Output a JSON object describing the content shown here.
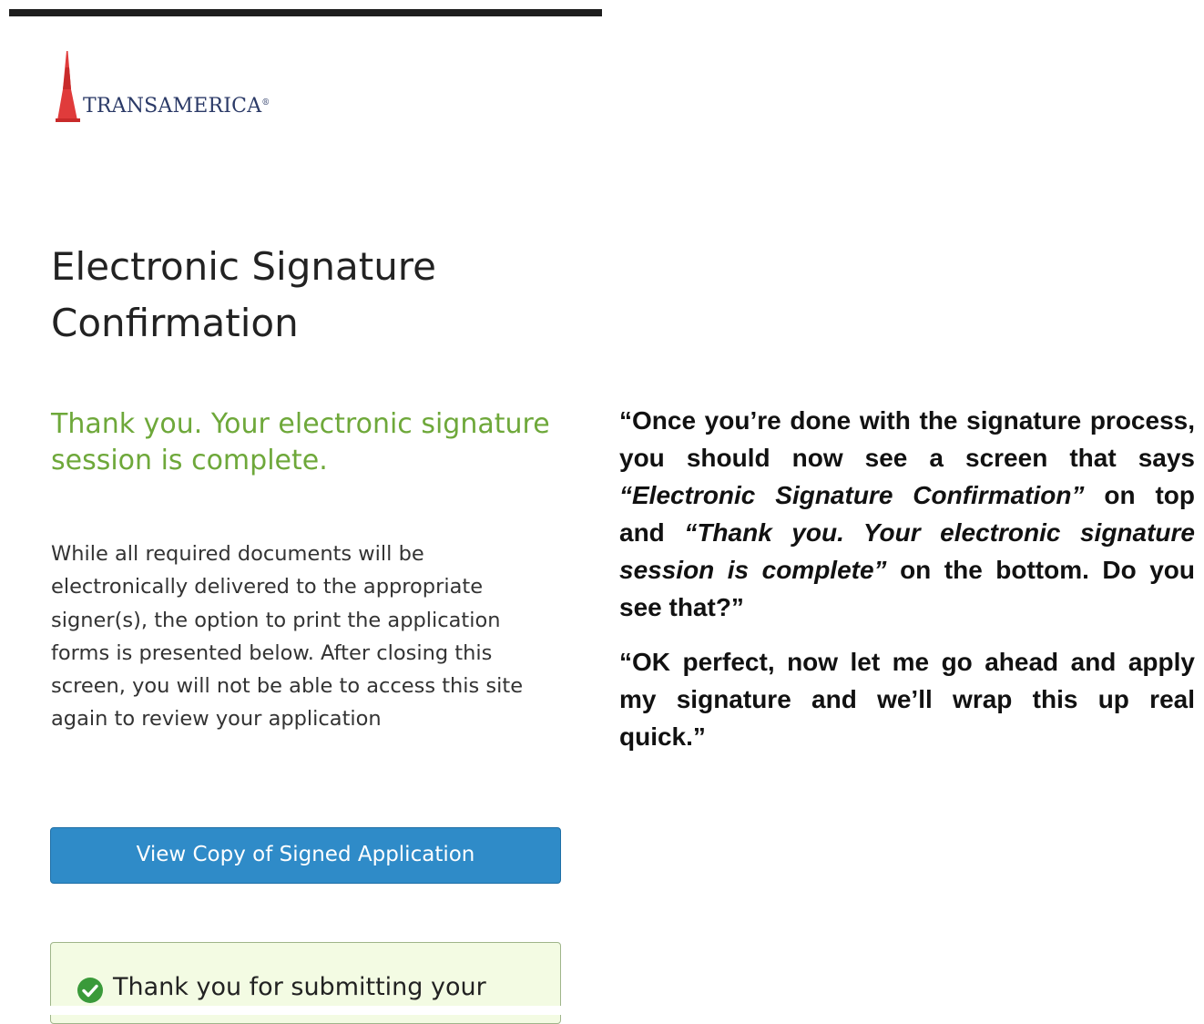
{
  "brand": {
    "logo_text": "TRANSAMERICA",
    "logo_registered": "®",
    "accent_color": "#e03b3b",
    "logo_text_color": "#2b3a67"
  },
  "page": {
    "title": "Electronic Signature Confirmation",
    "thank_you": "Thank you. Your electronic signature session is complete.",
    "info": "While all required documents will be electronically delivered to the appropriate signer(s), the option to print the application forms is presented below. After closing this screen, you will not be able to access this site again to review your application",
    "view_button_label": "View Copy of Signed Application",
    "success_message": "Thank you for submitting your",
    "success_color": "#6ea83a",
    "button_color": "#2f8bc8"
  },
  "annotation": {
    "quote1_pre": "“Once you’re done with the signature process, you should now see a screen that says ",
    "quote1_em1": "“Electronic Signature Confirmation”",
    "quote1_mid": " on top and ",
    "quote1_em2": "“Thank you. Your electronic signature session is complete”",
    "quote1_post": " on the bottom. Do you see that?”",
    "quote2": "“OK perfect, now let me go ahead and apply my signature and we’ll wrap this up real quick.”"
  }
}
